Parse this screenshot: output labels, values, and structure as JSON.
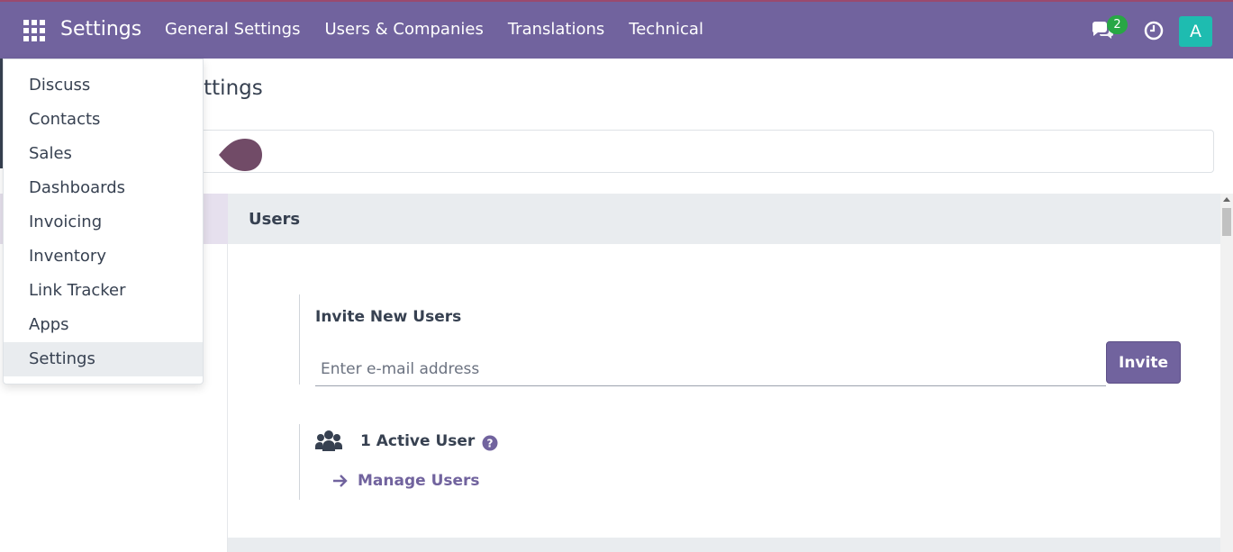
{
  "navbar": {
    "brand": "Settings",
    "menu": [
      "General Settings",
      "Users & Companies",
      "Translations",
      "Technical"
    ],
    "messages_badge": "2",
    "avatar_letter": "A",
    "colors": {
      "navbar": "#71639e",
      "badge": "#28a745",
      "avatar": "#1ebcb0"
    },
    "icons": [
      "apps-grid-icon",
      "chat-icon",
      "clock-icon"
    ]
  },
  "app_menu": {
    "items": [
      "Discuss",
      "Contacts",
      "Sales",
      "Dashboards",
      "Invoicing",
      "Inventory",
      "Link Tracker",
      "Apps",
      "Settings"
    ],
    "active": "Settings"
  },
  "page": {
    "title": "ettings"
  },
  "users_section": {
    "title": "Users",
    "invite_title": "Invite New Users",
    "invite_placeholder": "Enter e-mail address",
    "invite_button": "Invite",
    "active_users": "1 Active User",
    "manage_users": "Manage Users",
    "icons": [
      "users-icon",
      "help-icon",
      "arrow-right-icon"
    ]
  }
}
